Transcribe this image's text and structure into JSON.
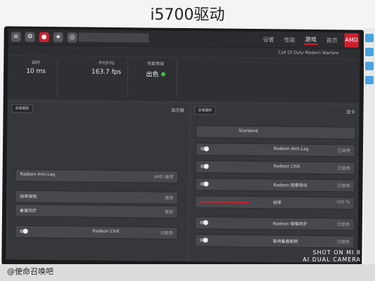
{
  "caption": "i5700驱动",
  "app": {
    "nav_tabs": [
      "首页",
      "游戏",
      "性能",
      "设置"
    ],
    "active_tab": "游戏",
    "game_title": "Call Of Duty Modern Warfare",
    "logo": "AMD"
  },
  "stats": [
    {
      "label": "延时",
      "value": "10 ms"
    },
    {
      "label": "平均FPS",
      "value": "163.7 fps"
    },
    {
      "label": "性能等级",
      "value": "出色"
    },
    {
      "label": "",
      "value": ""
    }
  ],
  "left_panel": {
    "back_label": "全局图形",
    "section": "显示器",
    "rows": [
      {
        "label": "Radeon Anti-Lag",
        "value": "AMD 推荐"
      },
      {
        "label": "",
        "value": ""
      },
      {
        "label": "帧率限制",
        "value": "禁用"
      },
      {
        "label": "垂直同步",
        "value": "禁用"
      },
      {
        "label": "Radeon Chill",
        "value": "已禁用"
      }
    ]
  },
  "right_panel": {
    "back_label": "全局图形",
    "section": "显卡",
    "profile": "Standard",
    "rows": [
      {
        "label": "Radeon Anti-Lag",
        "value": "已禁用"
      },
      {
        "label": "Radeon Chill",
        "value": "已禁用"
      },
      {
        "label": "Radeon 图像锐化",
        "value": "已禁用"
      },
      {
        "label": "帧率",
        "value": "100 %"
      },
      {
        "label": "Radeon 增强同步",
        "value": "已禁用"
      },
      {
        "label": "等待垂直刷新",
        "value": "已禁用"
      }
    ]
  },
  "watermark_left": "@使命召唤吧",
  "watermark_right_line1": "SHOT ON MI 8",
  "watermark_right_line2": "AI DUAL CAMERA"
}
